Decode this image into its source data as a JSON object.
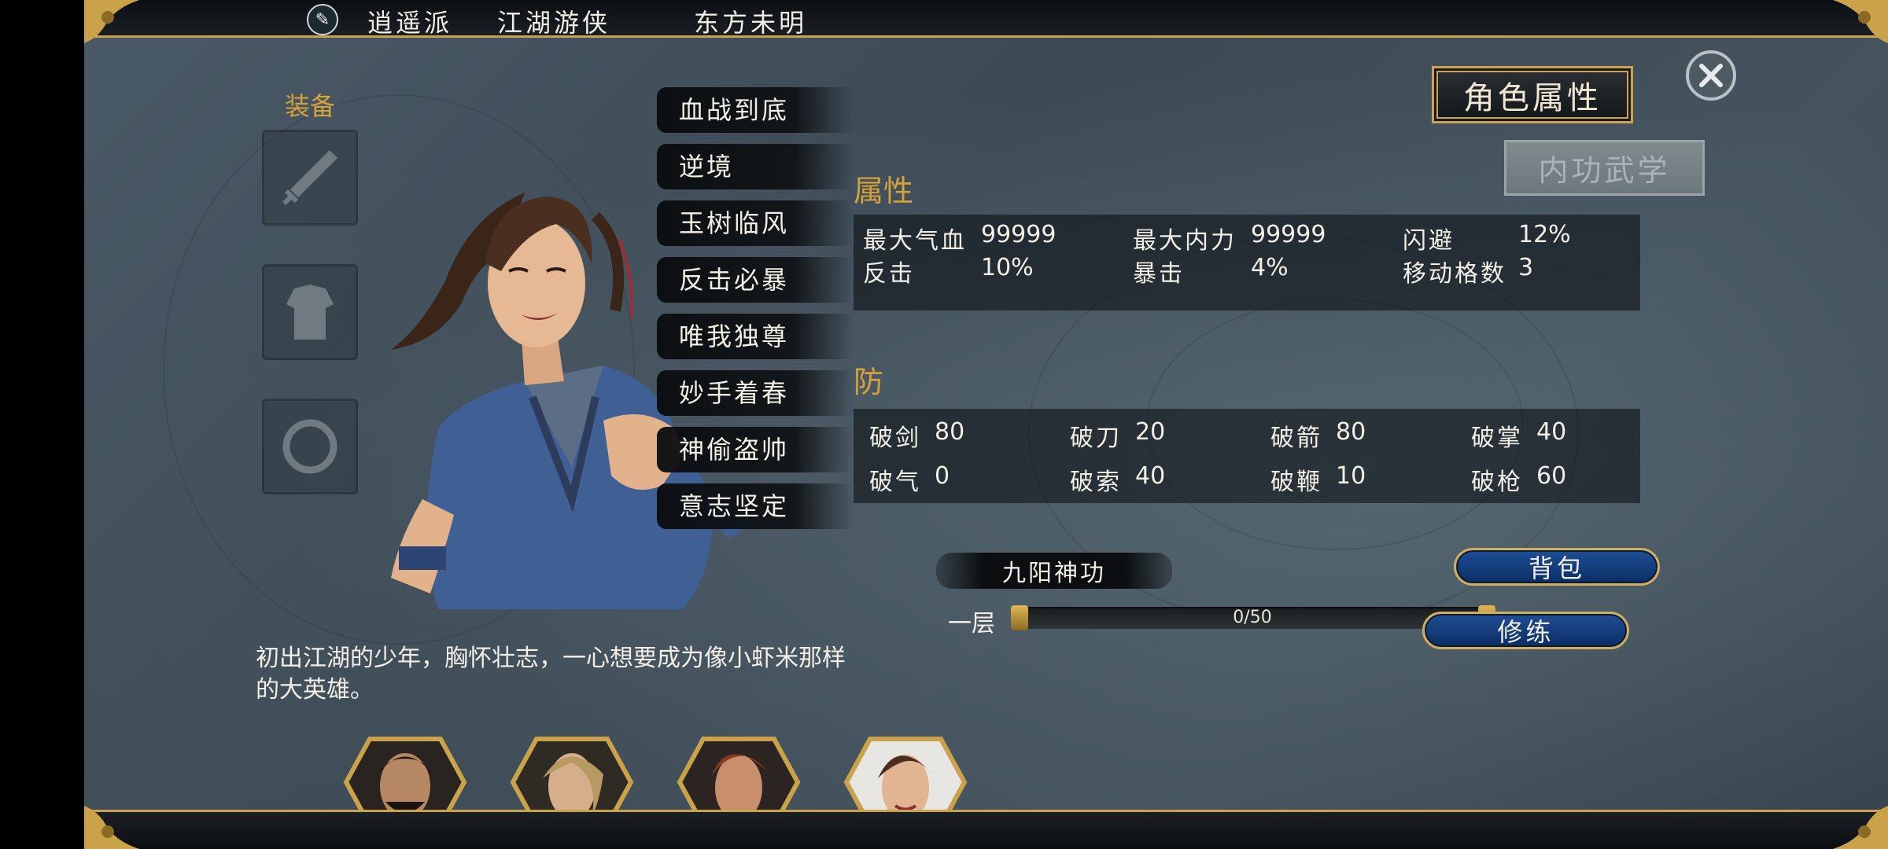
{
  "header": {
    "sect": "逍遥派",
    "role": "江湖游侠",
    "name": "东方未明",
    "sect_icon": "brush-emblem-icon"
  },
  "equipment": {
    "title": "装备",
    "slots": [
      "sword-slot-icon",
      "armor-slot-icon",
      "ring-slot-icon"
    ]
  },
  "traits": [
    "血战到底",
    "逆境",
    "玉树临风",
    "反击必暴",
    "唯我独尊",
    "妙手着春",
    "神偷盗帅",
    "意志坚定"
  ],
  "tabs": {
    "attributes": "角色属性",
    "neigong": "内功武学"
  },
  "attributes": {
    "title": "属性",
    "rows": [
      [
        {
          "label": "最大气血",
          "value": "99999"
        },
        {
          "label": "最大内力",
          "value": "99999"
        },
        {
          "label": "闪避",
          "value": "12%"
        }
      ],
      [
        {
          "label": "反击",
          "value": "10%"
        },
        {
          "label": "暴击",
          "value": "4%"
        },
        {
          "label": "移动格数",
          "value": "3"
        }
      ]
    ]
  },
  "defense": {
    "title": "防",
    "rows": [
      [
        {
          "label": "破剑",
          "value": "80"
        },
        {
          "label": "破刀",
          "value": "20"
        },
        {
          "label": "破箭",
          "value": "80"
        },
        {
          "label": "破掌",
          "value": "40"
        }
      ],
      [
        {
          "label": "破气",
          "value": "0"
        },
        {
          "label": "破索",
          "value": "40"
        },
        {
          "label": "破鞭",
          "value": "10"
        },
        {
          "label": "破枪",
          "value": "60"
        }
      ]
    ]
  },
  "skill": {
    "name": "九阳神功",
    "level": "一层",
    "progress_text": "0/50",
    "progress": 0
  },
  "buttons": {
    "bag": "背包",
    "train": "修练"
  },
  "bio": "初出江湖的少年，胸怀壮志，一心想要成为像小虾米那样的大英雄。",
  "party": [
    "warrior-portrait",
    "blonde-portrait",
    "redhair-portrait",
    "hero-portrait-selected"
  ],
  "colors": {
    "gold": "#d4a13a",
    "frame_gold": "#c9a24a",
    "button_blue": "#1f4e96"
  }
}
